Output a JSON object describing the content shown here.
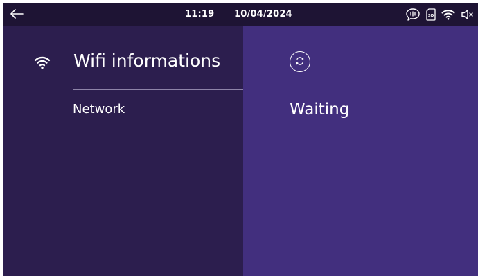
{
  "statusbar": {
    "time": "11:19",
    "date": "10/04/2024",
    "icons": [
      "back-arrow-icon",
      "chat-bubble-icon",
      "sd-card-icon",
      "wifi-icon",
      "speaker-muted-icon"
    ],
    "sd_label": "SD"
  },
  "wifi_panel": {
    "title": "Wifi informations",
    "network_label": "Network",
    "icon": "wifi-icon"
  },
  "detail_panel": {
    "status": "Waiting",
    "icon": "refresh-icon"
  },
  "colors": {
    "statusbar_bg": "#1e1434",
    "left_panel_bg": "#2c1e4e",
    "right_panel_bg": "#422f7e",
    "divider": "#8e84a8",
    "text": "#ffffff"
  }
}
